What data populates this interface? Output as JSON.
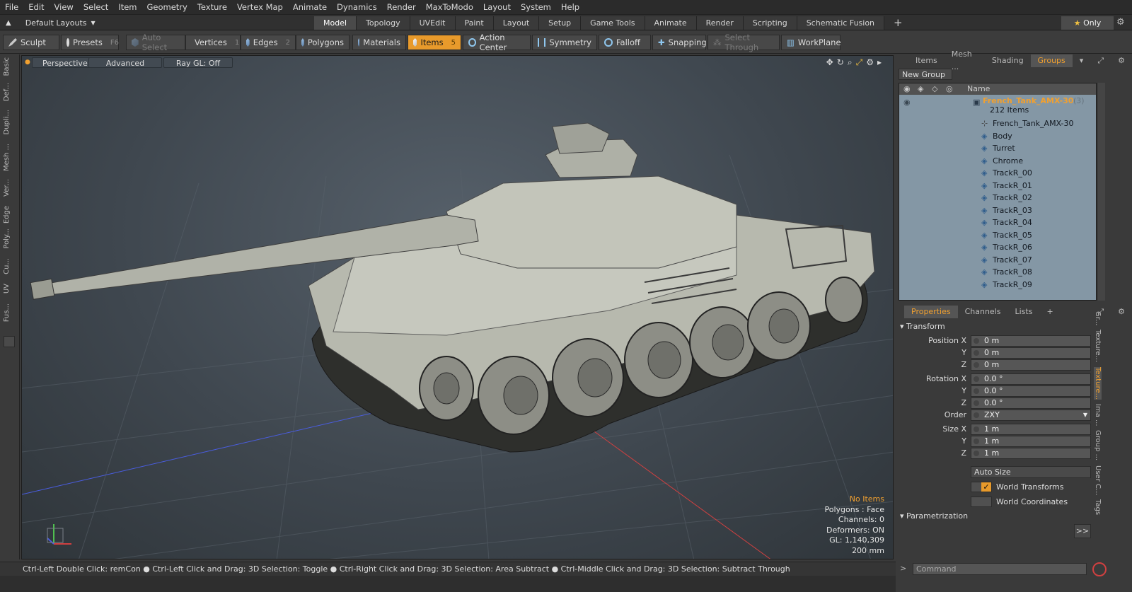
{
  "menu": [
    "File",
    "Edit",
    "View",
    "Select",
    "Item",
    "Geometry",
    "Texture",
    "Vertex Map",
    "Animate",
    "Dynamics",
    "Render",
    "MaxToModo",
    "Layout",
    "System",
    "Help"
  ],
  "layout_selector": "Default Layouts",
  "mode_tabs": [
    "Model",
    "Topology",
    "UVEdit",
    "Paint",
    "Layout",
    "Setup",
    "Game Tools",
    "Animate",
    "Render",
    "Scripting",
    "Schematic Fusion"
  ],
  "active_mode_tab": "Model",
  "only_button": "Only",
  "toolbar": {
    "sculpt": "Sculpt",
    "presets": "Presets",
    "presets_key": "F6",
    "auto_select": "Auto Select",
    "vertices": "Vertices",
    "vertices_key": "1",
    "edges": "Edges",
    "edges_key": "2",
    "polygons": "Polygons",
    "materials": "Materials",
    "items": "Items",
    "items_key": "5",
    "action_center": "Action Center",
    "symmetry": "Symmetry",
    "falloff": "Falloff",
    "snapping": "Snapping",
    "select_through": "Select Through",
    "workplane": "WorkPlane"
  },
  "left_strip": [
    "Basic",
    "Def...",
    "Dupli...",
    "Mesh ...",
    "Ver...",
    "Edge",
    "Poly...",
    "Cu...",
    "UV",
    "Fus..."
  ],
  "viewport": {
    "view": "Perspective",
    "advanced": "Advanced",
    "raygl": "Ray GL: Off",
    "hud": {
      "no_items": "No Items",
      "polygons": "Polygons : Face",
      "channels": "Channels: 0",
      "deformers": "Deformers: ON",
      "gl": "GL: 1,140,309",
      "scale": "200 mm"
    }
  },
  "status_bar": "Ctrl-Left Double Click: remCon ● Ctrl-Left Click and Drag: 3D Selection: Toggle ● Ctrl-Right Click and Drag: 3D Selection: Area Subtract ● Ctrl-Middle Click and Drag: 3D Selection: Subtract Through",
  "groups_panel": {
    "tabs": [
      "Items",
      "Mesh ...",
      "Shading",
      "Groups"
    ],
    "active_tab": "Groups",
    "new_group": "New Group",
    "column_name": "Name",
    "root": {
      "name": "French_Tank_AMX-30",
      "count": "(3)",
      "sub": "212 Items"
    },
    "children": [
      "French_Tank_AMX-30",
      "Body",
      "Turret",
      "Chrome",
      "TrackR_00",
      "TrackR_01",
      "TrackR_02",
      "TrackR_03",
      "TrackR_04",
      "TrackR_05",
      "TrackR_06",
      "TrackR_07",
      "TrackR_08",
      "TrackR_09"
    ]
  },
  "properties_panel": {
    "tabs": [
      "Properties",
      "Channels",
      "Lists"
    ],
    "active_tab": "Properties",
    "section_transform": "Transform",
    "position": {
      "label": "Position X",
      "x": "0 m",
      "y": "0 m",
      "z": "0 m"
    },
    "rotation": {
      "label": "Rotation X",
      "x": "0.0 °",
      "y": "0.0 °",
      "z": "0.0 °"
    },
    "order": {
      "label": "Order",
      "value": "ZXY"
    },
    "size": {
      "label": "Size X",
      "x": "1 m",
      "y": "1 m",
      "z": "1 m"
    },
    "axis_y": "Y",
    "axis_z": "Z",
    "auto_size": "Auto Size",
    "world_transforms": "World Transforms",
    "world_coordinates": "World Coordinates",
    "section_param": "Parametrization",
    "more": ">>"
  },
  "right_vtabs": [
    "Gr...",
    "Texture...",
    "Texture...",
    "Ima ...",
    "Group ...",
    "User C...",
    "Tags"
  ],
  "command_placeholder": "Command",
  "colors": {
    "accent": "#e89a2b",
    "tree_bg": "#8497a5",
    "root_label": "#f0a030"
  }
}
